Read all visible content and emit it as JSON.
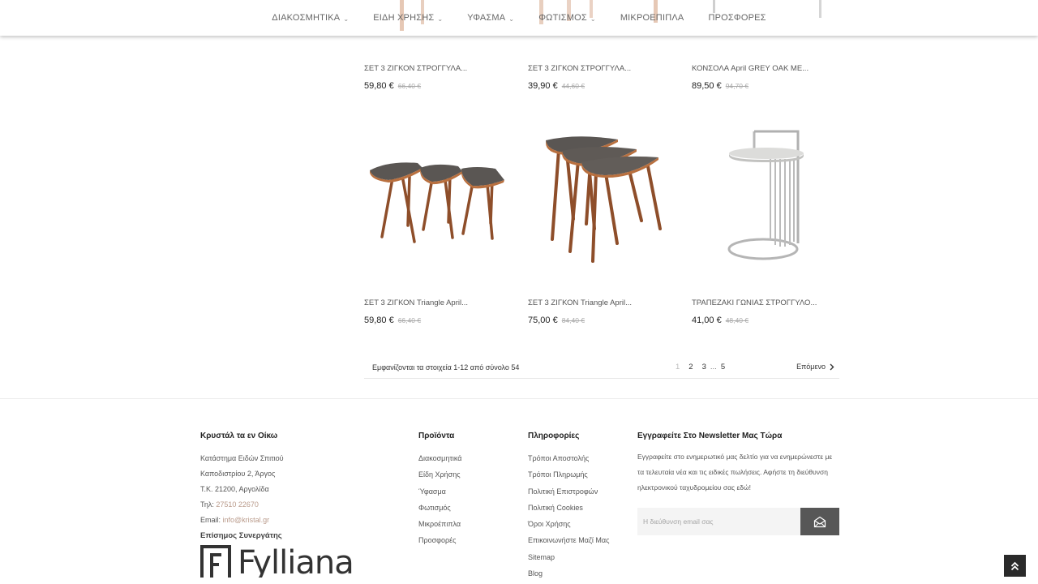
{
  "nav": {
    "items": [
      {
        "label": "ΔΙΑΚΟΣΜΗΤΙΚΑ",
        "dropdown": true
      },
      {
        "label": "ΕΙΔΗ ΧΡΗΣΗΣ",
        "dropdown": true
      },
      {
        "label": "ΥΦΑΣΜΑ",
        "dropdown": true
      },
      {
        "label": "ΦΩΤΙΣΜΟΣ",
        "dropdown": true
      },
      {
        "label": "ΜΙΚΡΟΕΠΙΠΛΑ",
        "dropdown": false
      },
      {
        "label": "ΠΡΟΣΦΟΡΕΣ",
        "dropdown": false
      }
    ]
  },
  "products": [
    {
      "name": "ΣΕΤ 3 ΖΙΓΚΟΝ ΣΤΡΟΓΓΥΛΑ...",
      "price": "59,80 €",
      "old_price": "66,40 €"
    },
    {
      "name": "ΣΕΤ 3 ΖΙΓΚΟΝ ΣΤΡΟΓΓΥΛΑ...",
      "price": "39,90 €",
      "old_price": "44,60 €"
    },
    {
      "name": "ΚΟΝΣΟΛΑ April GREY OAK ΜΕ...",
      "price": "89,50 €",
      "old_price": "94,70 €"
    },
    {
      "name": "ΣΕΤ 3 ΖΙΓΚΟΝ Triangle April...",
      "price": "59,80 €",
      "old_price": "66,40 €",
      "image": "triangle-nesting-tables-row"
    },
    {
      "name": "ΣΕΤ 3 ΖΙΓΚΟΝ Triangle April...",
      "price": "75,00 €",
      "old_price": "84,40 €",
      "image": "triangle-nesting-tables-stacked"
    },
    {
      "name": "ΤΡΑΠΕΖΑΚΙ ΓΩΝΙΑΣ ΣΤΡΟΓΓΥΛΟ...",
      "price": "41,00 €",
      "old_price": "48,40 €",
      "image": "round-metal-side-table"
    }
  ],
  "pagination": {
    "summary": "Εμφανίζονται τα στοιχεία 1-12 από σύνολο 54",
    "pages": [
      "1",
      "2",
      "3",
      "...",
      "5"
    ],
    "current": "1",
    "next_label": "Επόμενο"
  },
  "footer": {
    "store": {
      "title": "Κρυστάλ τα εν Οίκω",
      "lines": [
        "Κατάστημα Ειδών Σπιτιού",
        "Καποδιστρίου 2, Άργος",
        "Τ.Κ. 21200, Αργολίδα"
      ],
      "phone_label": "Τηλ:",
      "phone": "27510 22670",
      "email_label": "Email:",
      "email": "info@kristal.gr",
      "partner_title": "Επίσημος Συνεργάτης",
      "partner_logo": "Fylliana"
    },
    "products_col": {
      "title": "Προϊόντα",
      "links": [
        "Διακοσμητικά",
        "Είδη Χρήσης",
        "Ύφασμα",
        "Φωτισμός",
        "Μικροέπιπλα",
        "Προσφορές"
      ]
    },
    "info_col": {
      "title": "Πληροφορίες",
      "links": [
        "Τρόποι Αποστολής",
        "Τρόποι Πληρωμής",
        "Πολιτική Επιστροφών",
        "Πολιτική Cookies",
        "Όροι Χρήσης",
        "Επικοινωνήστε Μαζί Μας",
        "Sitemap",
        "Blog"
      ]
    },
    "newsletter": {
      "title": "Εγγραφείτε Στο Newsletter Μας Τώρα",
      "text": "Εγγραφείτε στο ενημερωτικό μας δελτίο για να ενημερώνεστε με τα τελευταία νέα και τις ειδικές πωλήσεις. Αφήστε τη διεύθυνση ηλεκτρονικού ταχυδρομείου σας εδώ!",
      "placeholder": "Η διεύθυνση email σας",
      "button_icon": "envelope-icon"
    }
  },
  "icons": {
    "back_to_top": "double-chevron-up-icon",
    "next": "chevron-right-icon",
    "dropdown": "chevron-down-icon"
  },
  "colors": {
    "accent_link": "#b99a8a",
    "button_dark": "#575757",
    "back_to_top": "#2a2a2a"
  }
}
